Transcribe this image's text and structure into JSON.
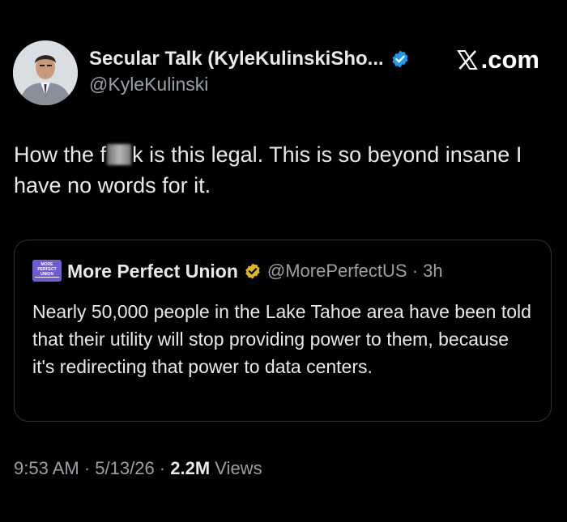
{
  "author": {
    "display_name": "Secular Talk (KyleKulinskiSho...",
    "handle": "@KyleKulinski",
    "verified_color": "#1d9bf0"
  },
  "site": {
    "label": ".com",
    "icon": "x-logo-icon"
  },
  "tweet": {
    "text_before": "How the f",
    "text_after": "k is this legal. This is so beyond insane I have no words for it."
  },
  "quoted": {
    "avatar_text": "MORE PERFECT UNION",
    "avatar_color": "#6e5bd6",
    "name": "More Perfect Union",
    "badge_color": "#e2b719",
    "handle": "@MorePerfectUS",
    "separator": "·",
    "time": "3h",
    "text": "Nearly 50,000 people in the Lake Tahoe area have been told that their utility will stop providing power to them, because it's redirecting that power to data centers."
  },
  "meta": {
    "time": "9:53 AM",
    "sep1": " · ",
    "date": "5/13/26",
    "sep2": " · ",
    "views_count": "2.2M",
    "views_label": " Views"
  }
}
